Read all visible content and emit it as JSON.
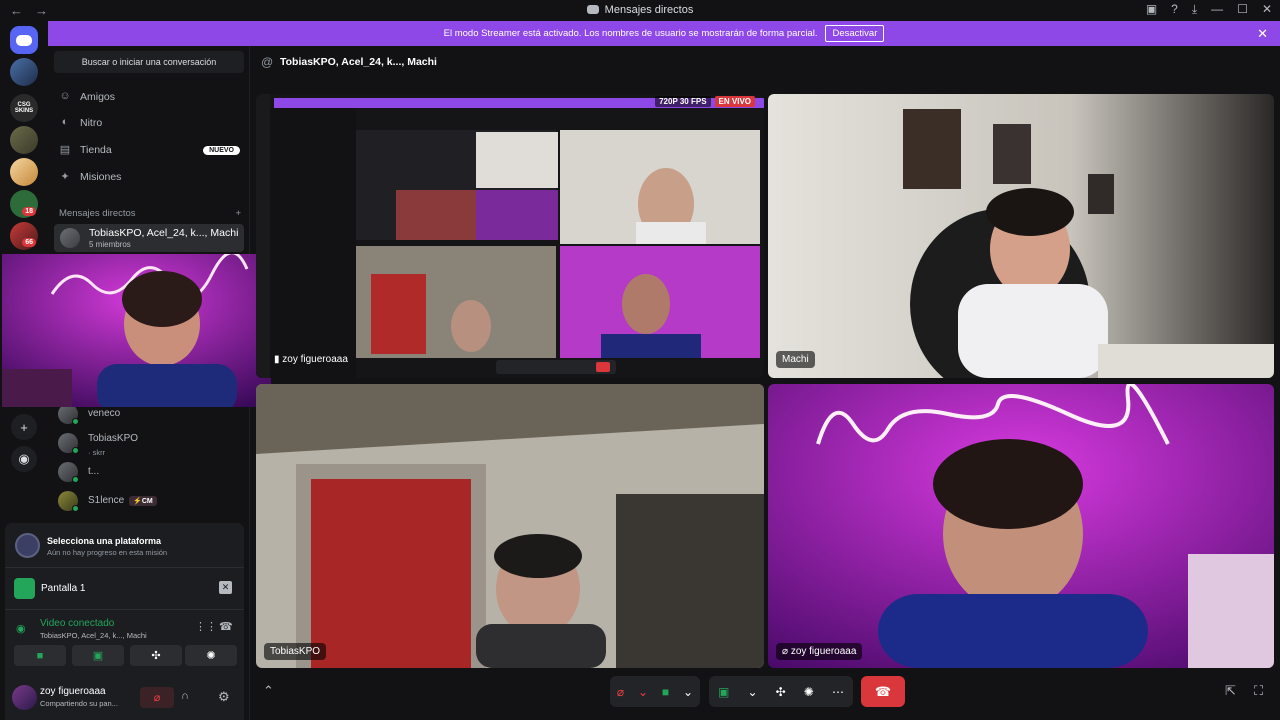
{
  "window": {
    "title": "Mensajes directos"
  },
  "banner": {
    "text": "El modo Streamer está activado. Los nombres de usuario se mostrarán de forma parcial.",
    "button": "Desactivar"
  },
  "servers": [
    {
      "label": "",
      "badge": ""
    },
    {
      "label": "",
      "badge": ""
    },
    {
      "label": "CSG SKINS",
      "badge": ""
    },
    {
      "label": "",
      "badge": ""
    },
    {
      "label": "",
      "badge": ""
    },
    {
      "label": "",
      "badge": "18"
    },
    {
      "label": "",
      "badge": "66"
    }
  ],
  "sidebar": {
    "search_label": "Buscar o iniciar una conversación",
    "nav": [
      {
        "label": "Amigos",
        "icon": "friends-icon"
      },
      {
        "label": "Nitro",
        "icon": "nitro-icon"
      },
      {
        "label": "Tienda",
        "icon": "shop-icon",
        "badge": "NUEVO"
      },
      {
        "label": "Misiones",
        "icon": "quests-icon"
      }
    ],
    "dm_header": "Mensajes directos",
    "active_dm": {
      "name": "TobiasKPO, Acel_24, k..., Machi",
      "sub": "5 miembros"
    },
    "dms": [
      {
        "name": "veneco",
        "sub": ""
      },
      {
        "name": "TobiasKPO",
        "sub": "· skrr"
      },
      {
        "name": "t...",
        "sub": ""
      },
      {
        "name": "S1lence",
        "sub": "",
        "tag": "CM"
      }
    ]
  },
  "panel": {
    "quest_title": "Selecciona una plataforma",
    "quest_sub": "Aún no hay progreso en esta misión",
    "screen_label": "Pantalla 1",
    "voice_status": "Video conectado",
    "voice_channel": "TobiasKPO, Acel_24, k..., Machi",
    "username": "zoy figueroaaa",
    "user_status": "Compartiendo su pan..."
  },
  "call": {
    "header": "TobiasKPO, Acel_24, k..., Machi",
    "tiles": [
      {
        "name": "zoy figueroaaa",
        "quality": "720P 30 FPS",
        "live": "EN VIVO"
      },
      {
        "name": "Machi"
      },
      {
        "name": "TobiasKPO"
      },
      {
        "name": "zoy figueroaaa"
      }
    ]
  },
  "colors": {
    "accent": "#5865f2",
    "streamer_banner": "#8f48e8",
    "online": "#23a55a",
    "danger": "#da373c"
  }
}
